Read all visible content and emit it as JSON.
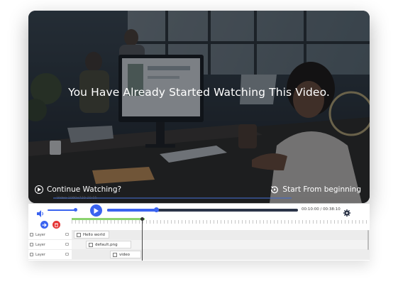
{
  "video": {
    "headline": "You Have Already Started Watching This Video.",
    "continue_label": "Continue Watching?",
    "restart_label": "Start From beginning",
    "faint_caption": "Video 1080x720 20.05"
  },
  "controls": {
    "volume_level": 0.9,
    "progress": 0.26,
    "current_time": "00:10:00",
    "separator": "/",
    "total_time": "00:38:10"
  },
  "tracks": [
    {
      "label": "Layer",
      "clip": "Hello world"
    },
    {
      "label": "Layer",
      "clip": "default.png"
    },
    {
      "label": "Layer",
      "clip": "video"
    }
  ],
  "icons": {
    "volume": "speaker-icon",
    "play": "play-icon",
    "settings": "gear-icon",
    "add_track": "arrow-right-icon",
    "delete_track": "trash-icon",
    "continue": "play-circle-icon",
    "restart": "replay-icon"
  },
  "colors": {
    "accent": "#3a63f0",
    "danger": "#e53434",
    "ruler_progress": "#8bd36e",
    "seek_track": "#2b3448"
  }
}
